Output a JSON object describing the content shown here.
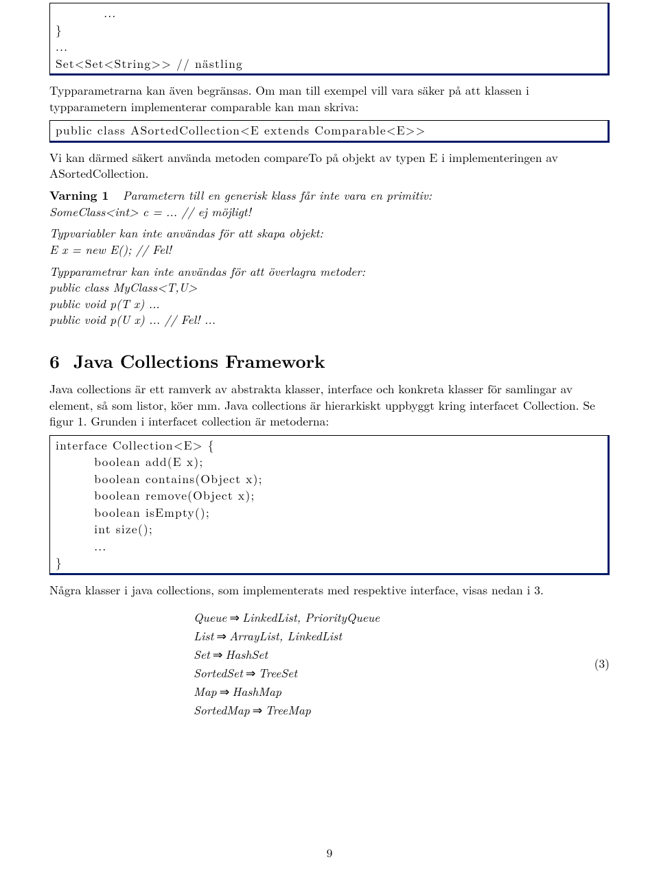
{
  "code1": "          ...\n}\n...\nSet<Set<String>> // nästling",
  "para1": "Typparametrarna kan även begränsas. Om man till exempel vill vara säker på att klassen i typparametern implementerar comparable kan man skriva:",
  "code2": "public class ASortedCollection<E extends Comparable<E>>",
  "para2": "Vi kan därmed säkert använda metoden compareTo på objekt av typen E i implementeringen av ASortedCollection.",
  "warn_label": "Varning 1",
  "warn_body": "Parametern till en generisk klass får inte vara en primitiv:",
  "warn_line2": "SomeClass<int> c = ... // ej möjligt!",
  "block2_l1": "Typvariabler kan inte användas för att skapa objekt:",
  "block2_l2": "E x = new E(); // Fel!",
  "block3_l1": "Typparametrar kan inte användas för att överlagra metoder:",
  "block3_l2": "public class MyClass<T,U>",
  "block3_l3": "public void p(T x) ...",
  "block3_l4": "public void p(U x) ... // Fel! ...",
  "section_num": "6",
  "section_title": "Java Collections Framework",
  "para3": "Java collections är ett ramverk av abstrakta klasser, interface och konkreta klasser för samlingar av element, så som listor, köer mm. Java collections är hierarkiskt uppbyggt kring interfacet Collection. Se figur 1. Grunden i interfacet collection är metoderna:",
  "code3": "interface Collection<E> {\n        boolean add(E x);\n        boolean contains(Object x);\n        boolean remove(Object x);\n        boolean isEmpty();\n        int size();\n        ...\n}",
  "para4": "Några klasser i java collections, som implementerats med respektive interface, visas nedan i 3.",
  "eq": {
    "l1a": "Queue",
    "l1b": "LinkedList, PriorityQueue",
    "l2a": "List",
    "l2b": "ArrayList, LinkedList",
    "l3a": "Set",
    "l3b": "HashSet",
    "l4a": "SortedSet",
    "l4b": "TreeSet",
    "l5a": "Map",
    "l5b": "HashMap",
    "l6a": "SortedMap",
    "l6b": "TreeMap",
    "num": "(3)"
  },
  "pagenum": "9"
}
